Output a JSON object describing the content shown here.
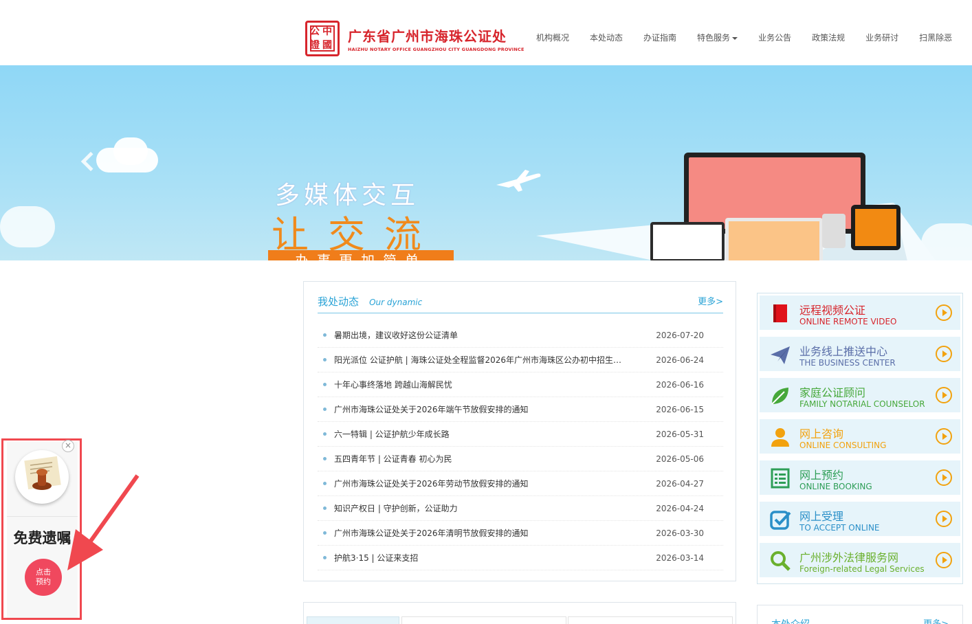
{
  "header": {
    "logo_seal": [
      "中",
      "國",
      "公",
      "證"
    ],
    "logo_cn": "广东省广州市海珠公证处",
    "logo_en": "HAIZHU NOTARY OFFICE GUANGZHOU CITY GUANGDONG PROVINCE",
    "nav": [
      "机构概况",
      "本处动态",
      "办证指南",
      "特色服务",
      "业务公告",
      "政策法规",
      "业务研讨",
      "扫黑除恶"
    ]
  },
  "banner": {
    "line1": "多媒体交互",
    "line2": "让交流",
    "line3": "办事更加简单",
    "active_slide": 3,
    "slide_count": 4
  },
  "news": {
    "title": "我处动态",
    "subtitle": "Our dynamic",
    "more": "更多>",
    "items": [
      {
        "text": "暑期出境，建议收好这份公证清单",
        "date": "2026-07-20"
      },
      {
        "text": "阳光派位 公证护航 | 海珠公证处全程监督2026年广州市海珠区公办初中招生 ...",
        "date": "2026-06-24"
      },
      {
        "text": "十年心事终落地 跨越山海解民忧",
        "date": "2026-06-16"
      },
      {
        "text": "广州市海珠公证处关于2026年端午节放假安排的通知",
        "date": "2026-06-15"
      },
      {
        "text": "六一特辑 | 公证护航少年成长路",
        "date": "2026-05-31"
      },
      {
        "text": "五四青年节 | 公证青春 初心为民",
        "date": "2026-05-06"
      },
      {
        "text": "广州市海珠公证处关于2026年劳动节放假安排的通知",
        "date": "2026-04-27"
      },
      {
        "text": "知识产权日 | 守护创新，公证助力",
        "date": "2026-04-24"
      },
      {
        "text": "广州市海珠公证处关于2026年清明节放假安排的通知",
        "date": "2026-03-30"
      },
      {
        "text": "护航3·15 | 公证来支招",
        "date": "2026-03-14"
      }
    ]
  },
  "services": [
    {
      "cn": "远程视频公证",
      "en": "ONLINE REMOTE VIDEO",
      "color": "#d7252c",
      "icon": "book-icon"
    },
    {
      "cn": "业务线上推送中心",
      "en": "THE BUSINESS CENTER",
      "color": "#5a6ea8",
      "icon": "paper-plane-icon"
    },
    {
      "cn": "家庭公证顾问",
      "en": "FAMILY NOTARIAL COUNSELOR",
      "color": "#46a83a",
      "icon": "leaf-icon"
    },
    {
      "cn": "网上咨询",
      "en": "ONLINE CONSULTING",
      "color": "#f2a20e",
      "icon": "user-icon"
    },
    {
      "cn": "网上预约",
      "en": "ONLINE BOOKING",
      "color": "#2e9e57",
      "icon": "list-icon"
    },
    {
      "cn": "网上受理",
      "en": "TO ACCEPT ONLINE",
      "color": "#2a8fc8",
      "icon": "checkbox-icon"
    },
    {
      "cn": "广州涉外法律服务网",
      "en": "Foreign-related Legal Services",
      "color": "#6ab02d",
      "icon": "search-icon"
    }
  ],
  "bottom": {
    "right_title": "本处介绍",
    "right_more": "更多>"
  },
  "float_widget": {
    "close": "×",
    "title": "免费遗嘱",
    "button_line1": "点击",
    "button_line2": "预约"
  }
}
